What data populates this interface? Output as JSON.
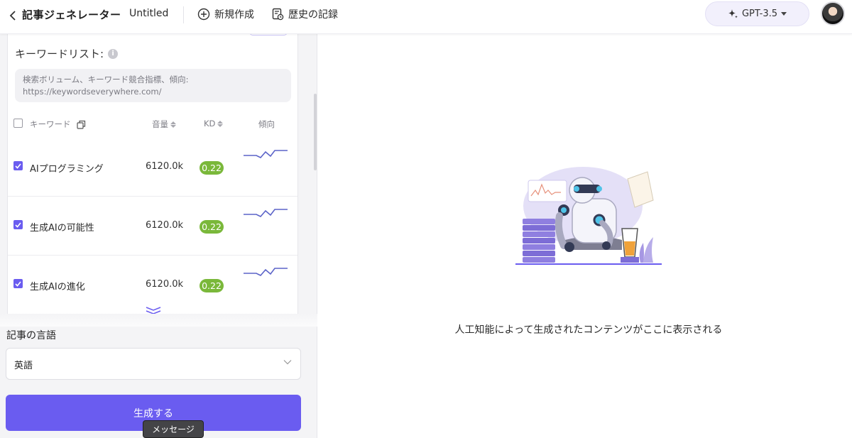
{
  "header": {
    "app_title": "記事ジェネレーター",
    "doc_name": "Untitled",
    "new_label": "新規作成",
    "history_label": "歴史の記録",
    "model_label": "GPT-3.5"
  },
  "keywords": {
    "title": "キーワードリスト:",
    "hint_line1": "検索ボリューム、キーワード競合指標、傾向:",
    "hint_line2": "https://keywordseverywhere.com/",
    "columns": {
      "keyword": "キーワード",
      "volume": "音量",
      "kd": "KD",
      "trend": "傾向"
    },
    "rows": [
      {
        "name": "AIプログラミング",
        "volume": "6120.0k",
        "kd": "0.22",
        "checked": true
      },
      {
        "name": "生成AIの可能性",
        "volume": "6120.0k",
        "kd": "0.22",
        "checked": true
      },
      {
        "name": "生成AIの進化",
        "volume": "6120.0k",
        "kd": "0.22",
        "checked": true
      }
    ]
  },
  "language": {
    "label": "記事の言語",
    "value": "英語"
  },
  "generate_label": "生成する",
  "tooltip": "メッセージ",
  "empty_state": "人工知能によって生成されたコンテンツがここに表示される",
  "colors": {
    "accent": "#6a5cf0",
    "kd_badge": "#7ab83a",
    "illustration": "#c9c1f0"
  }
}
